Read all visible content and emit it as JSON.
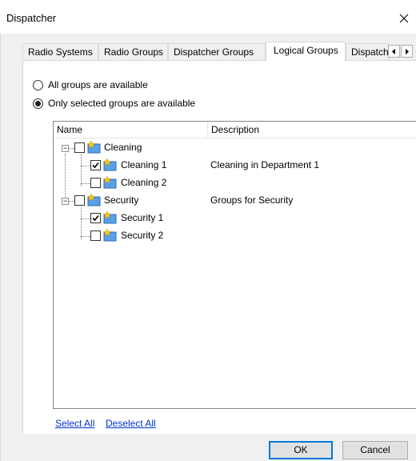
{
  "window": {
    "title": "Dispatcher"
  },
  "tabs": [
    {
      "label": "Radio Systems"
    },
    {
      "label": "Radio Groups"
    },
    {
      "label": "Dispatcher Groups"
    },
    {
      "label": "Logical Groups",
      "active": true
    },
    {
      "label": "Dispatch"
    }
  ],
  "availability": {
    "all_label": "All groups are available",
    "selected_label": "Only selected groups are available",
    "selected_option": "selected"
  },
  "tree": {
    "columns": [
      "Name",
      "Description"
    ],
    "rows": [
      {
        "name": "Cleaning",
        "description": "",
        "checked": false
      },
      {
        "name": "Cleaning 1",
        "description": "Cleaning in Department 1",
        "checked": true
      },
      {
        "name": "Cleaning 2",
        "description": "",
        "checked": false
      },
      {
        "name": "Security",
        "description": "Groups for Security",
        "checked": false
      },
      {
        "name": "Security 1",
        "description": "",
        "checked": true
      },
      {
        "name": "Security 2",
        "description": "",
        "checked": false
      }
    ]
  },
  "links": {
    "select_all": "Select All",
    "deselect_all": "Deselect All"
  },
  "buttons": {
    "ok": "OK",
    "cancel": "Cancel"
  },
  "colors": {
    "link": "#0033cc",
    "default_button_border": "#0078d7",
    "window_bg": "#f0f0f0"
  }
}
